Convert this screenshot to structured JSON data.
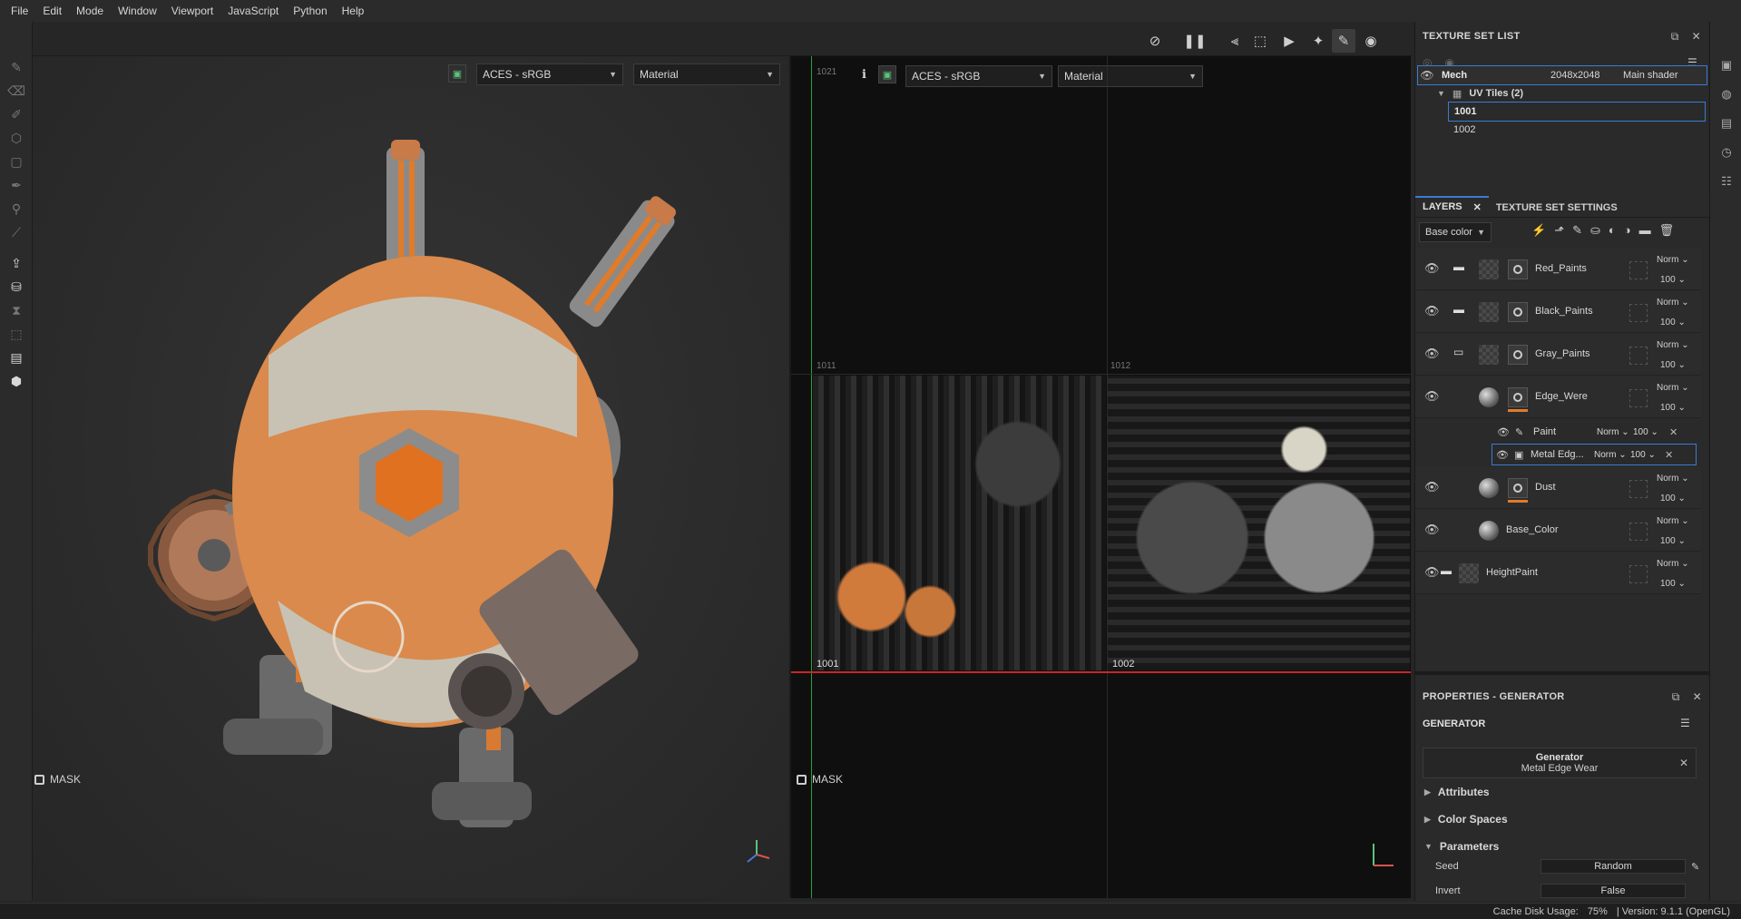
{
  "menu": [
    "File",
    "Edit",
    "Mode",
    "Window",
    "Viewport",
    "JavaScript",
    "Python",
    "Help"
  ],
  "viewport3d": {
    "colorspace": "ACES - sRGB",
    "channel": "Material",
    "mask_label": "MASK"
  },
  "viewport2d": {
    "colorspace": "ACES - sRGB",
    "channel": "Material",
    "mask_label": "MASK",
    "tiles": {
      "t1021": "1021",
      "t1011": "1011",
      "t1012": "1012",
      "t1001": "1001",
      "t1002": "1002"
    }
  },
  "texture_set_list": {
    "title": "TEXTURE SET LIST",
    "set_name": "Mech",
    "resolution": "2048x2048",
    "shader": "Main shader",
    "uv_tiles_label": "UV Tiles (2)",
    "tiles": [
      "1001",
      "1002"
    ]
  },
  "layers_panel": {
    "tab_layers": "LAYERS",
    "tab_settings": "TEXTURE SET SETTINGS",
    "channel": "Base color",
    "layers": [
      {
        "name": "Red_Paints",
        "blend": "Norm",
        "opacity": "100"
      },
      {
        "name": "Black_Paints",
        "blend": "Norm",
        "opacity": "100"
      },
      {
        "name": "Gray_Paints",
        "blend": "Norm",
        "opacity": "100"
      },
      {
        "name": "Edge_Were",
        "blend": "Norm",
        "opacity": "100"
      },
      {
        "name": "Dust",
        "blend": "Norm",
        "opacity": "100"
      },
      {
        "name": "Base_Color",
        "blend": "Norm",
        "opacity": "100"
      },
      {
        "name": "HeightPaint",
        "blend": "Norm",
        "opacity": "100"
      }
    ],
    "sub_layers": [
      {
        "name": "Paint",
        "blend": "Norm",
        "opacity": "100"
      },
      {
        "name": "Metal Edg...",
        "blend": "Norm",
        "opacity": "100"
      }
    ]
  },
  "properties": {
    "title": "PROPERTIES - GENERATOR",
    "section": "GENERATOR",
    "generator_label": "Generator",
    "generator_name": "Metal Edge Wear",
    "attributes": "Attributes",
    "color_spaces": "Color Spaces",
    "parameters": "Parameters",
    "seed_label": "Seed",
    "seed_value": "Random",
    "invert_label": "Invert",
    "invert_value": "False"
  },
  "status": {
    "cache": "Cache Disk Usage:",
    "cache_value": "75%",
    "version": "| Version: 9.1.1 (OpenGL)"
  },
  "colors": {
    "accent": "#e07b2a",
    "selection": "#3a7bd5",
    "uv_border_red": "#c62828",
    "uv_border_green": "#2e9e3e"
  }
}
